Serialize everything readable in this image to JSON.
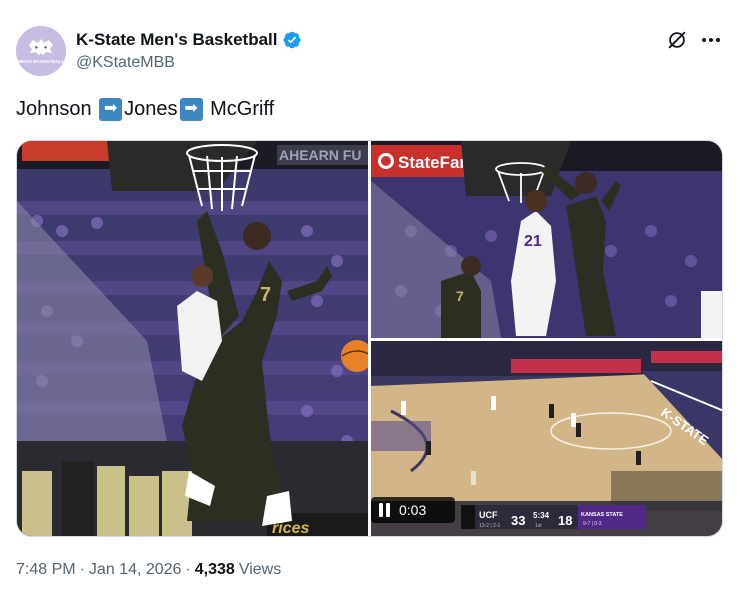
{
  "author": {
    "display_name": "K-State Men's Basketball",
    "handle": "@KStateMBB",
    "avatar_text": "MEN'S BASKETBALL",
    "verified": true
  },
  "tweet": {
    "text_parts": [
      "Johnson ",
      "Jones",
      " McGriff"
    ],
    "arrow_glyph": "➡"
  },
  "media": {
    "left_image_alt": "Player in black uniform number 7 jumping at the rim in front of the crowd",
    "top_right_alt": "Player in black uniform dunking over defender in white jersey",
    "bottom_right_alt": "Broadcast view of the basketball court during play",
    "signage": {
      "statefarm": "StateFarm",
      "ahearn": "AHEARN FU",
      "court_text": "K-STATE"
    },
    "scorebug": {
      "team1": "UCF",
      "team1_record": "13-2 | 2-1",
      "score1": "33",
      "clock": "5:34",
      "period": "1st",
      "score2": "18",
      "team2": "KANSAS STATE",
      "team2_record": "9-7 | 0-3"
    },
    "video_time": "0:03"
  },
  "meta": {
    "time": "7:48 PM",
    "separator": "·",
    "date": "Jan 14, 2026",
    "views_count": "4,338",
    "views_label": "Views"
  },
  "colors": {
    "kstate_purple": "#512888",
    "verified_blue": "#1d9bf0",
    "secondary_text": "#536471",
    "emoji_blue": "#3b88c3"
  },
  "icons": {
    "grok": "grok-icon",
    "more": "more-icon"
  }
}
